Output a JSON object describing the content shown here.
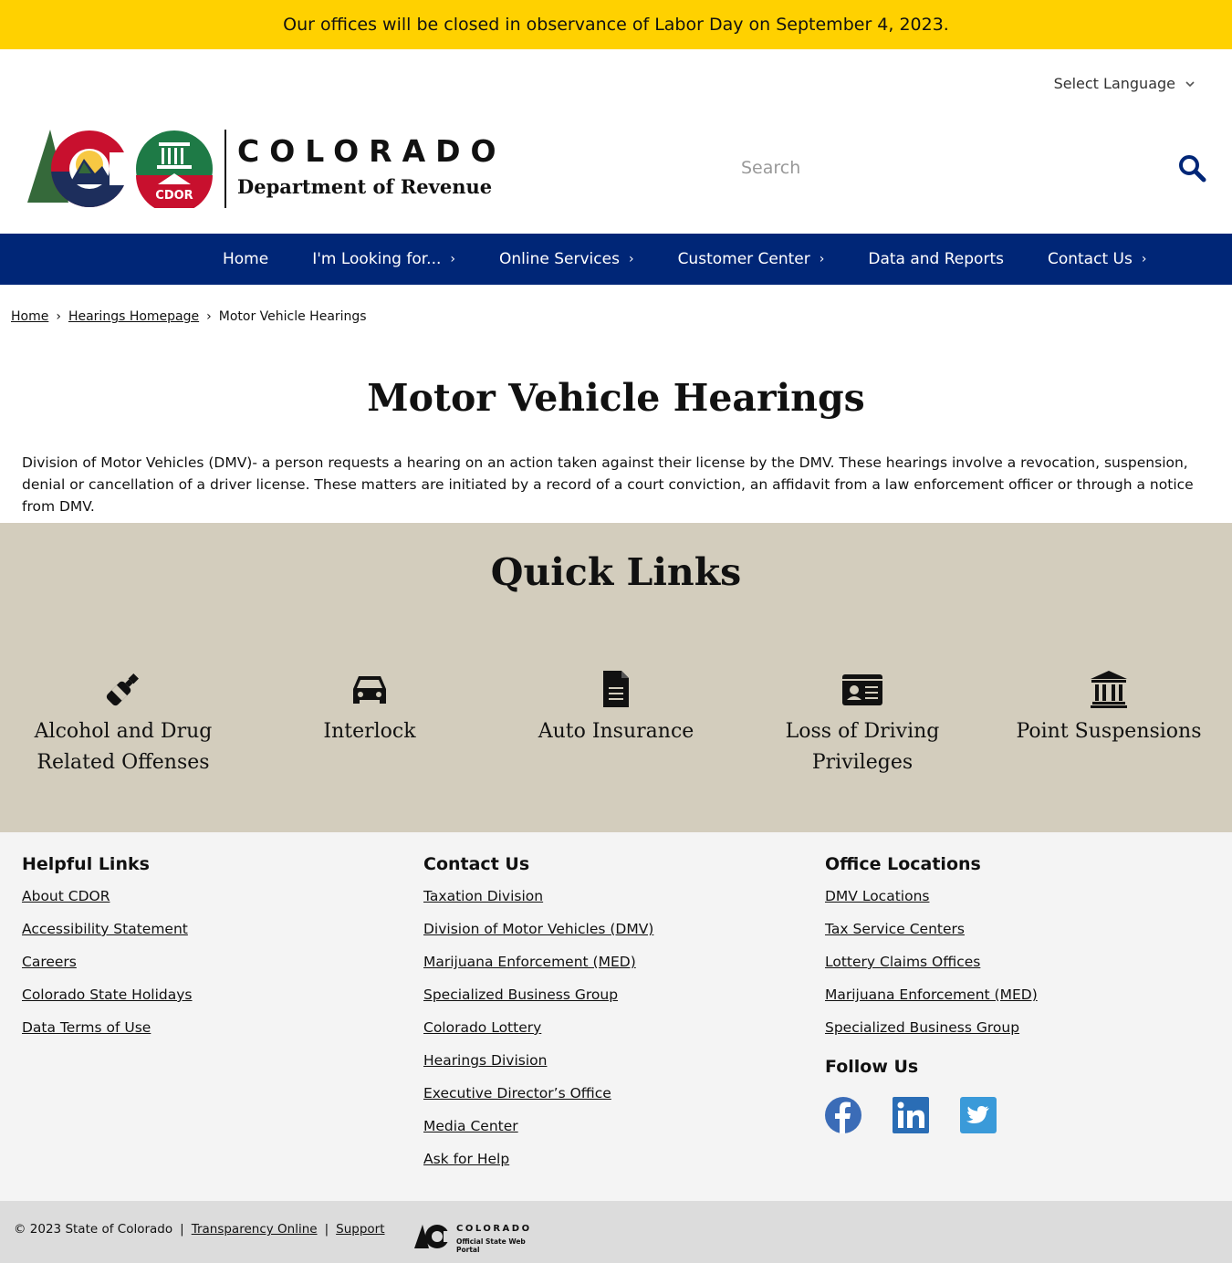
{
  "alert": {
    "text": "Our offices will be closed in observance of Labor Day on September 4, 2023."
  },
  "header": {
    "language_label": "Select Language",
    "logo_state_text": "COLORADO",
    "logo_dept_text": "Department of Revenue",
    "logo_seal_text": "CDOR",
    "search_placeholder": "Search",
    "search_value": ""
  },
  "nav": {
    "items": [
      {
        "label": "Home",
        "has_chevron": false
      },
      {
        "label": "I'm Looking for...",
        "has_chevron": true
      },
      {
        "label": "Online Services",
        "has_chevron": true
      },
      {
        "label": "Customer Center",
        "has_chevron": true
      },
      {
        "label": "Data and Reports",
        "has_chevron": false
      },
      {
        "label": "Contact Us",
        "has_chevron": true
      }
    ]
  },
  "breadcrumb": {
    "items": [
      "Home",
      "Hearings Homepage"
    ],
    "current": "Motor Vehicle Hearings",
    "separator": "›"
  },
  "main": {
    "title": "Motor Vehicle Hearings",
    "intro": "Division of Motor Vehicles (DMV)- a person requests a hearing on an action taken against their license by the DMV. These hearings involve a revocation, suspension, denial or cancellation of a driver license. These matters are initiated by a record of a court conviction, an affidavit from a law enforcement officer or through a notice from DMV."
  },
  "quick_links": {
    "title": "Quick Links",
    "items": [
      {
        "label": "Alcohol and Drug Related Offenses",
        "icon": "bottle-icon"
      },
      {
        "label": "Interlock",
        "icon": "car-icon"
      },
      {
        "label": "Auto Insurance",
        "icon": "document-icon"
      },
      {
        "label": "Loss of Driving Privileges",
        "icon": "id-card-icon"
      },
      {
        "label": "Point Suspensions",
        "icon": "institution-icon"
      }
    ]
  },
  "footer": {
    "helpful": {
      "title": "Helpful Links",
      "links": [
        "About CDOR",
        "Accessibility Statement",
        "Careers",
        "Colorado State Holidays",
        "Data Terms of Use"
      ]
    },
    "contact": {
      "title": "Contact Us",
      "links": [
        "Taxation Division",
        "Division of Motor Vehicles (DMV)",
        "Marijuana Enforcement (MED)",
        "Specialized Business Group",
        "Colorado Lottery",
        "Hearings Division",
        "Executive Director’s Office",
        "Media Center",
        "Ask for Help"
      ]
    },
    "offices": {
      "title": "Office Locations",
      "links": [
        "DMV Locations",
        "Tax Service Centers",
        "Lottery Claims Offices",
        "Marijuana Enforcement (MED)",
        "Specialized Business Group"
      ]
    },
    "follow": {
      "title": "Follow Us",
      "networks": [
        "facebook-icon",
        "linkedin-icon",
        "twitter-icon"
      ]
    }
  },
  "bottom": {
    "copyright": "© 2023 State of Colorado",
    "sep": "|",
    "links": [
      "Transparency Online",
      "Support"
    ],
    "portal_title": "COLORADO",
    "portal_subtitle": "Official State Web Portal"
  },
  "colors": {
    "alert_bg": "#ffd100",
    "nav_bg": "#002677",
    "quick_bg": "#d3cdbd",
    "footer_bg": "#f4f4f4",
    "bottom_bg": "#dcdcdc",
    "search_icon": "#002677"
  }
}
